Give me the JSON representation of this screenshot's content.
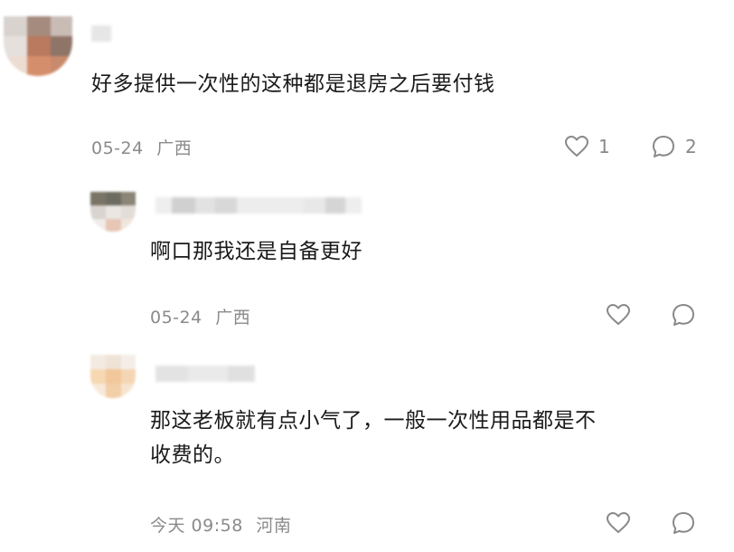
{
  "comments": [
    {
      "text": "好多提供一次性的这种都是退房之后要付钱",
      "date": "05-24",
      "location": "广西",
      "like_count": "1",
      "reply_count": "2"
    },
    {
      "text": "啊口那我还是自备更好",
      "date": "05-24",
      "location": "广西"
    },
    {
      "text_line1": "那这老板就有点小气了，一般一次性用品都是不",
      "text_line2": "收费的。",
      "date": "今天 09:58",
      "location": "河南"
    }
  ],
  "icons": {
    "like": "heart-outline-icon",
    "reply": "speech-bubble-icon"
  },
  "colors": {
    "meta_text": "#8a8a8a",
    "icon": "#888888",
    "background": "#ffffff"
  }
}
